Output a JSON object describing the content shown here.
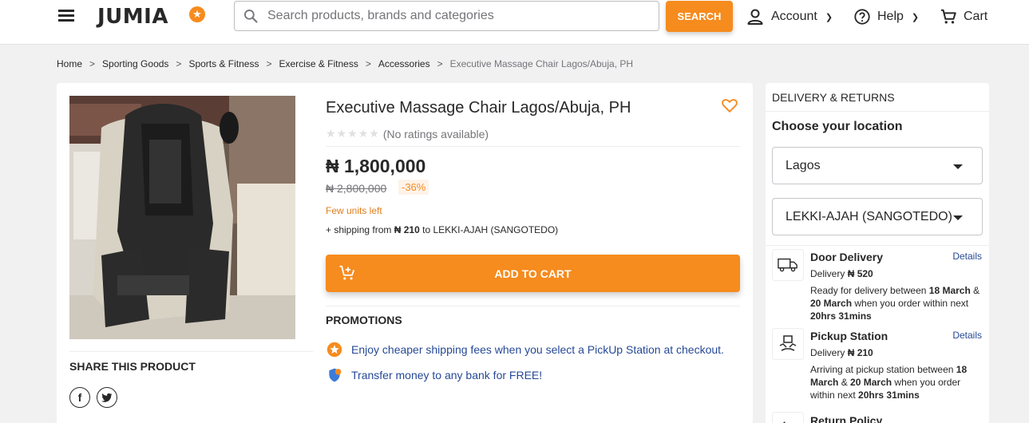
{
  "header": {
    "logo": "JUMIA",
    "search_placeholder": "Search products, brands and categories",
    "search_button": "SEARCH",
    "account": "Account",
    "help": "Help",
    "cart": "Cart"
  },
  "breadcrumb": [
    "Home",
    "Sporting Goods",
    "Sports & Fitness",
    "Exercise & Fitness",
    "Accessories",
    "Executive Massage Chair Lagos/Abuja, PH"
  ],
  "product": {
    "title": "Executive Massage Chair Lagos/Abuja, PH",
    "rating_text": "(No ratings available)",
    "price": "₦ 1,800,000",
    "old_price": "₦ 2,800,000",
    "discount": "-36%",
    "stock": "Few units left",
    "shipping_prefix": "+ shipping from",
    "shipping_amount": "₦ 210",
    "shipping_suffix": "to LEKKI-AJAH (SANGOTEDO)",
    "add_to_cart": "ADD TO CART"
  },
  "share": {
    "title": "SHARE THIS PRODUCT"
  },
  "promotions": {
    "title": "PROMOTIONS",
    "items": [
      "Enjoy cheaper shipping fees when you select a PickUp Station at checkout.",
      "Transfer money to any bank for FREE!"
    ]
  },
  "delivery": {
    "title": "DELIVERY & RETURNS",
    "choose_location": "Choose your location",
    "region": "Lagos",
    "city": "LEKKI-AJAH (SANGOTEDO)",
    "door": {
      "title": "Door Delivery",
      "details": "Details",
      "fee_label": "Delivery",
      "fee": "₦ 520",
      "text_a": "Ready for delivery between",
      "date1": "18 March",
      "text_b": "&",
      "date2": "20 March",
      "text_c": "when you order within next",
      "time": "20hrs 31mins"
    },
    "pickup": {
      "title": "Pickup Station",
      "details": "Details",
      "fee_label": "Delivery",
      "fee": "₦ 210",
      "text_a": "Arriving at pickup station between",
      "date1": "18 March",
      "text_b": "&",
      "date2": "20 March",
      "text_c": "when you order within next",
      "time": "20hrs 31mins"
    },
    "return_policy": "Return Policy"
  },
  "colors": {
    "accent": "#f68b1e",
    "link": "#264996"
  }
}
